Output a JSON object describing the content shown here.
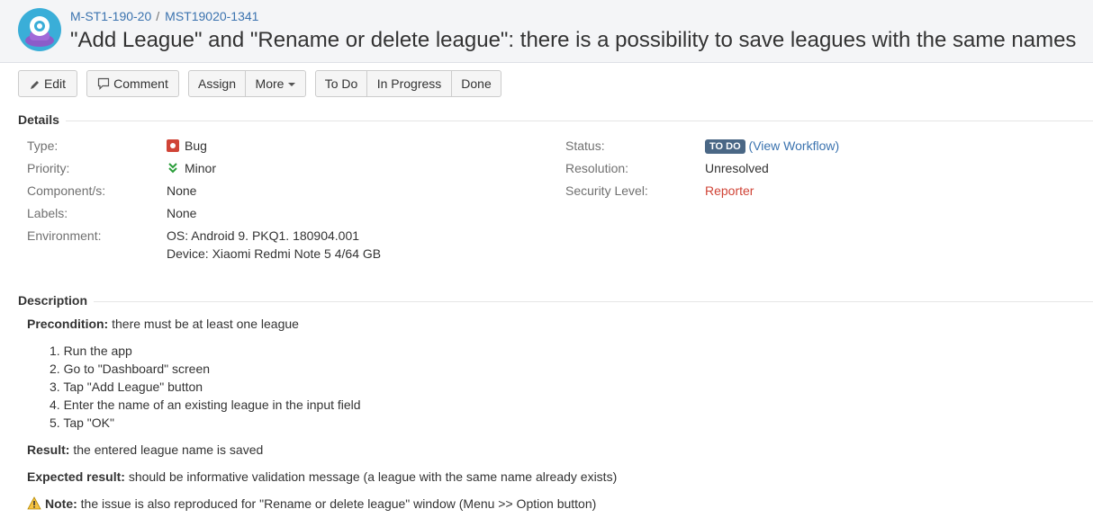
{
  "breadcrumb": {
    "project": "M-ST1-190-20",
    "separator": "/",
    "issue_key": "MST19020-1341"
  },
  "issue": {
    "summary": "\"Add League\" and \"Rename or delete league\": there is a possibility to save leagues with the same names"
  },
  "toolbar": {
    "edit": "Edit",
    "comment": "Comment",
    "assign": "Assign",
    "more": "More",
    "todo": "To Do",
    "in_progress": "In Progress",
    "done": "Done"
  },
  "details": {
    "title": "Details",
    "type_label": "Type:",
    "type_value": "Bug",
    "priority_label": "Priority:",
    "priority_value": "Minor",
    "components_label": "Component/s:",
    "components_value": "None",
    "labels_label": "Labels:",
    "labels_value": "None",
    "environment_label": "Environment:",
    "environment_line1": "OS: Android 9. PKQ1. 180904.001",
    "environment_line2": "Device: Xiaomi Redmi Note 5 4/64 GB",
    "status_label": "Status:",
    "status_value": "TO DO",
    "view_workflow_open": "(",
    "view_workflow": "View Workflow",
    "view_workflow_close": ")",
    "resolution_label": "Resolution:",
    "resolution_value": "Unresolved",
    "security_label": "Security Level:",
    "security_value": "Reporter"
  },
  "description": {
    "title": "Description",
    "precondition_label": "Precondition:",
    "precondition_text": " there must be at least one league",
    "steps": [
      "1. Run the app",
      "2. Go to \"Dashboard\" screen",
      "3. Tap \"Add League\" button",
      "4. Enter the name of an existing league in the input field",
      "5. Tap \"OK\""
    ],
    "result_label": "Result:",
    "result_text": " the entered league name is saved",
    "expected_label": "Expected result:",
    "expected_text": " should be informative validation message (a league with the same name already exists)",
    "note_label": "Note:",
    "note_text": " the issue is also reproduced for \"Rename or delete league\" window (Menu >> Option button)"
  },
  "colors": {
    "link": "#3b73af",
    "bug": "#d04437",
    "status_lozenge": "#4a6785",
    "priority_minor": "#2a9d3a"
  },
  "icons": {
    "avatar": "project-avatar",
    "edit": "pencil-icon",
    "comment": "comment-icon",
    "type": "bug-icon",
    "priority": "double-chevron-down-icon",
    "note": "warning-icon"
  }
}
